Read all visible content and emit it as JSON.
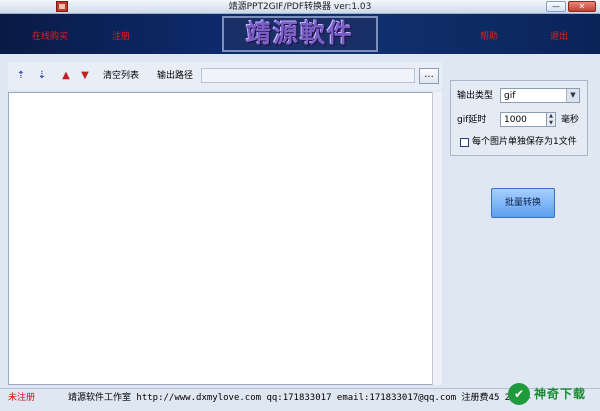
{
  "window": {
    "title": "靖源PPT2GIF/PDF转换器 ver:1.03",
    "min_glyph": "—",
    "close_glyph": "✕"
  },
  "banner": {
    "buy_label": "在线购买",
    "register_label": "注册",
    "logo_text": "靖源軟件",
    "help_label": "帮助",
    "exit_label": "退出"
  },
  "toolbar": {
    "icons": [
      "move-top-icon",
      "move-bottom-icon",
      "move-up-icon",
      "move-down-icon"
    ],
    "move_top_glyph": "⇡",
    "move_bottom_glyph": "⇣",
    "move_up_glyph": "▲",
    "move_down_glyph": "▼",
    "clear_list_label": "清空列表",
    "output_path_label": "输出路径",
    "output_path_value": "",
    "browse_label": "..."
  },
  "settings": {
    "output_type_label": "输出类型",
    "output_type_value": "gif",
    "delay_label": "gif延时",
    "delay_value": "1000",
    "delay_unit": "毫秒",
    "separate_label": "每个图片单独保存为1文件",
    "separate_checked": false
  },
  "actions": {
    "batch_convert_label": "批量转换"
  },
  "status": {
    "unregistered_label": "未注册",
    "info_text": "靖源软件工作室 http://www.dxmylove.com qq:171833017 email:171833017@qq.com 注册费45 2013-"
  },
  "watermark": {
    "icon_glyph": "✔",
    "text": "神奇下载"
  },
  "colors": {
    "link_red": "#e02020",
    "banner_dark": "#0d2a6a",
    "button_blue": "#5d9ff0",
    "badge_green": "#1f9a3c"
  }
}
